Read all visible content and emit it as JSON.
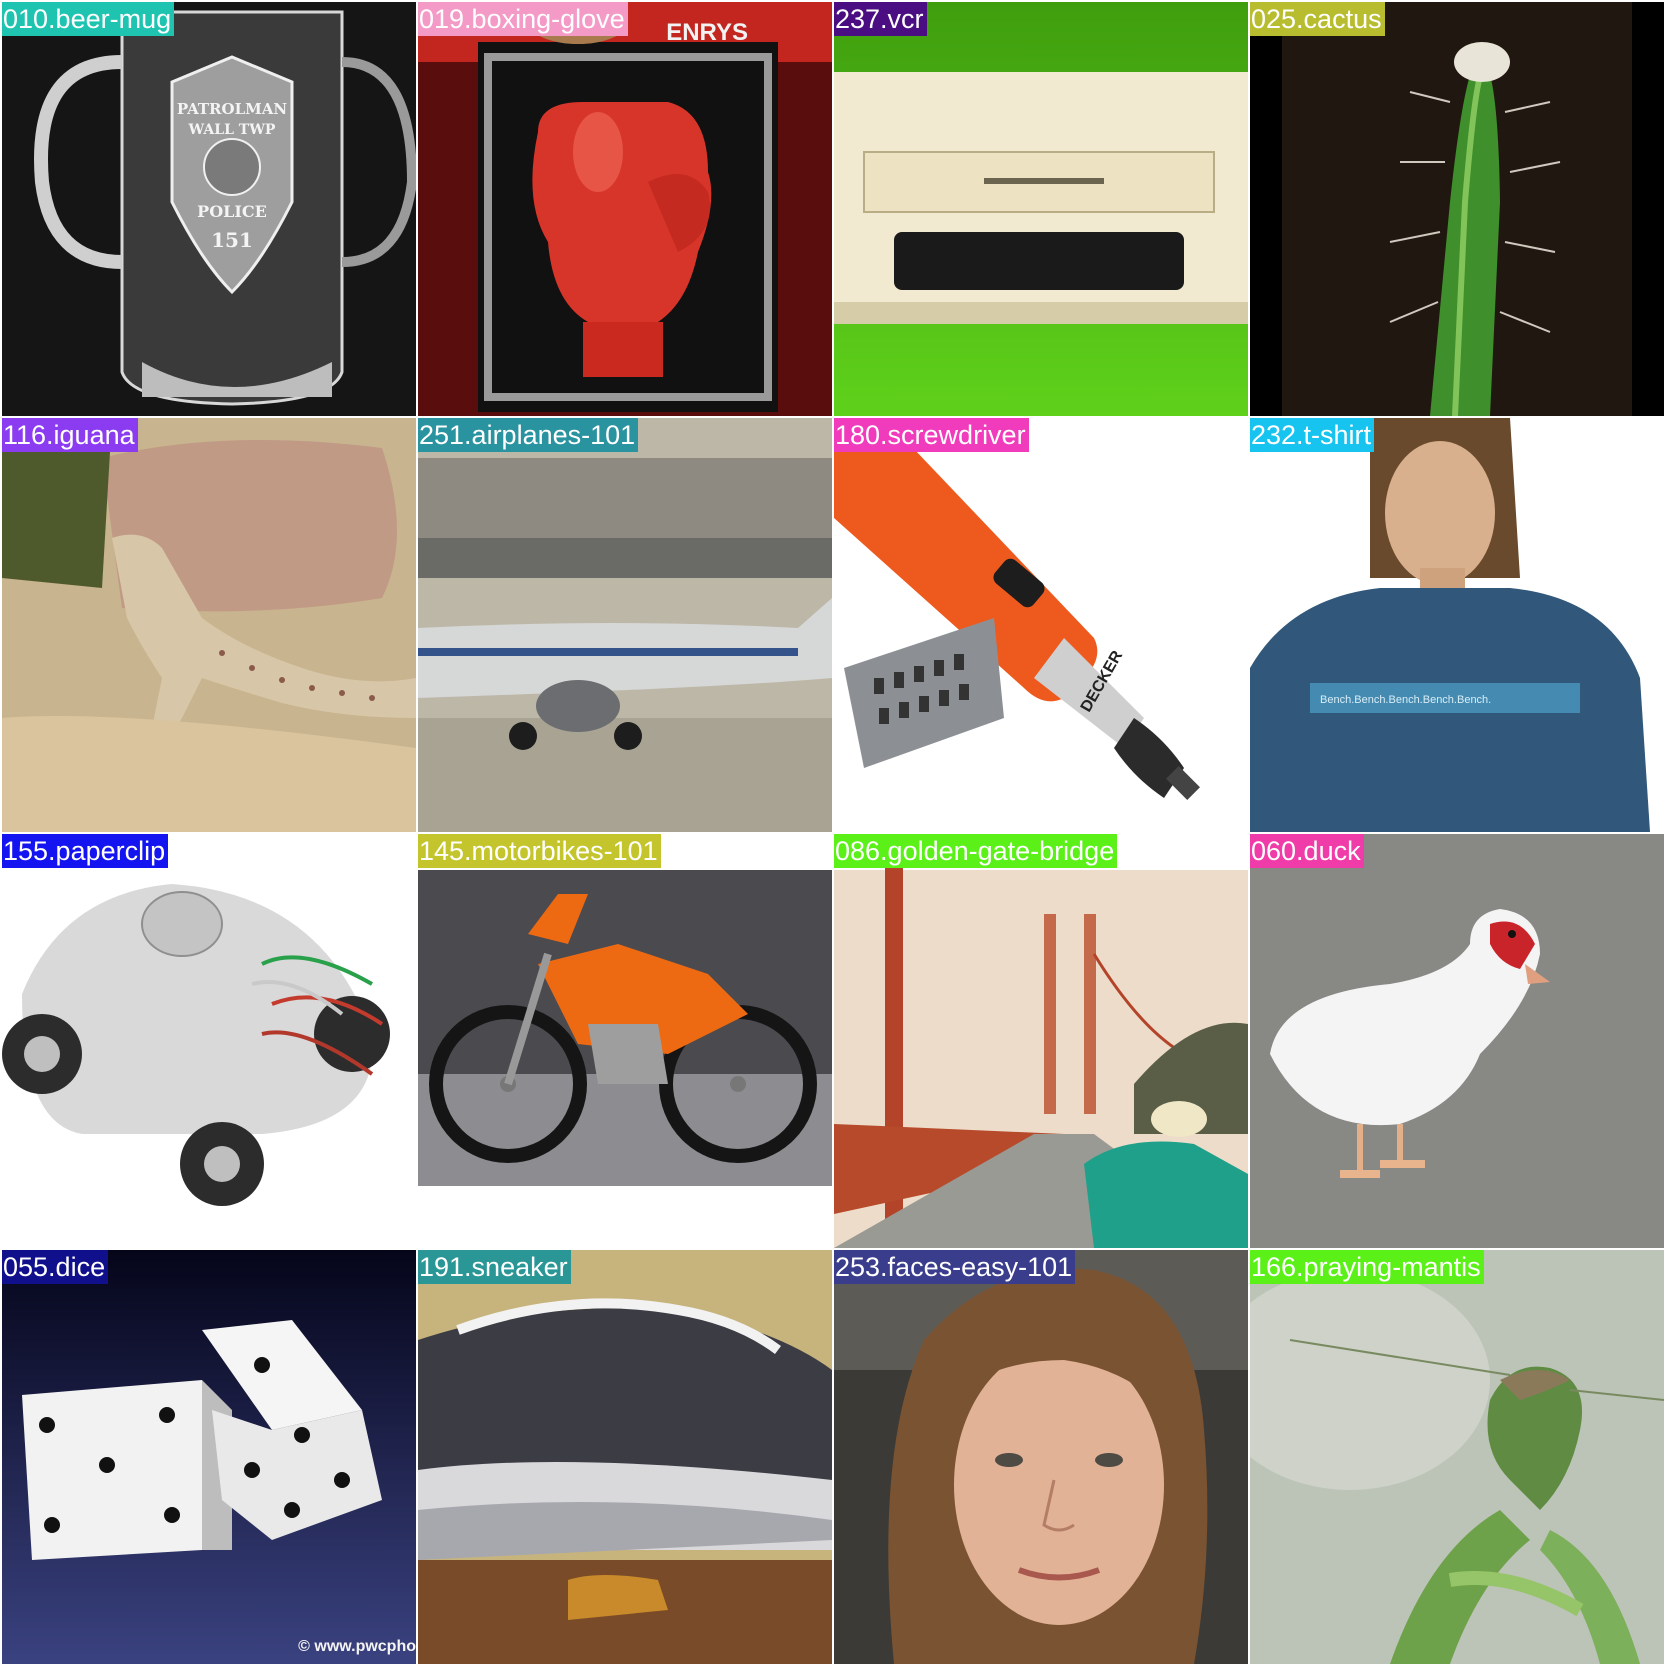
{
  "tiles": [
    {
      "label": "010.beer-mug",
      "color": "#1fc4b0"
    },
    {
      "label": "019.boxing-glove",
      "color": "#f49ac7"
    },
    {
      "label": "237.vcr",
      "color": "#4b0e82"
    },
    {
      "label": "025.cactus",
      "color": "#b8bd2f"
    },
    {
      "label": "116.iguana",
      "color": "#8c3cf0"
    },
    {
      "label": "251.airplanes-101",
      "color": "#2a93a0"
    },
    {
      "label": "180.screwdriver",
      "color": "#f03cbc"
    },
    {
      "label": "232.t-shirt",
      "color": "#17c3ef"
    },
    {
      "label": "155.paperclip",
      "color": "#1414f0"
    },
    {
      "label": "145.motorbikes-101",
      "color": "#c4c42c"
    },
    {
      "label": "086.golden-gate-bridge",
      "color": "#5cf019"
    },
    {
      "label": "060.duck",
      "color": "#f03ca8"
    },
    {
      "label": "055.dice",
      "color": "#10108c"
    },
    {
      "label": "191.sneaker",
      "color": "#2a9696"
    },
    {
      "label": "253.faces-easy-101",
      "color": "#3a3c8c"
    },
    {
      "label": "166.praying-mantis",
      "color": "#5cf019"
    }
  ],
  "scene_text": {
    "mug_badge_top": "PATROLMAN",
    "mug_badge_mid": "WALL TWP",
    "mug_badge_bottom": "POLICE",
    "mug_badge_number": "151",
    "glove_box_text": "ENRYS",
    "screwdriver_brand": "DECKER",
    "tshirt_print": "Bench.Bench.Bench.Bench.Bench.",
    "dice_watermark": "© www.pwcpho"
  }
}
